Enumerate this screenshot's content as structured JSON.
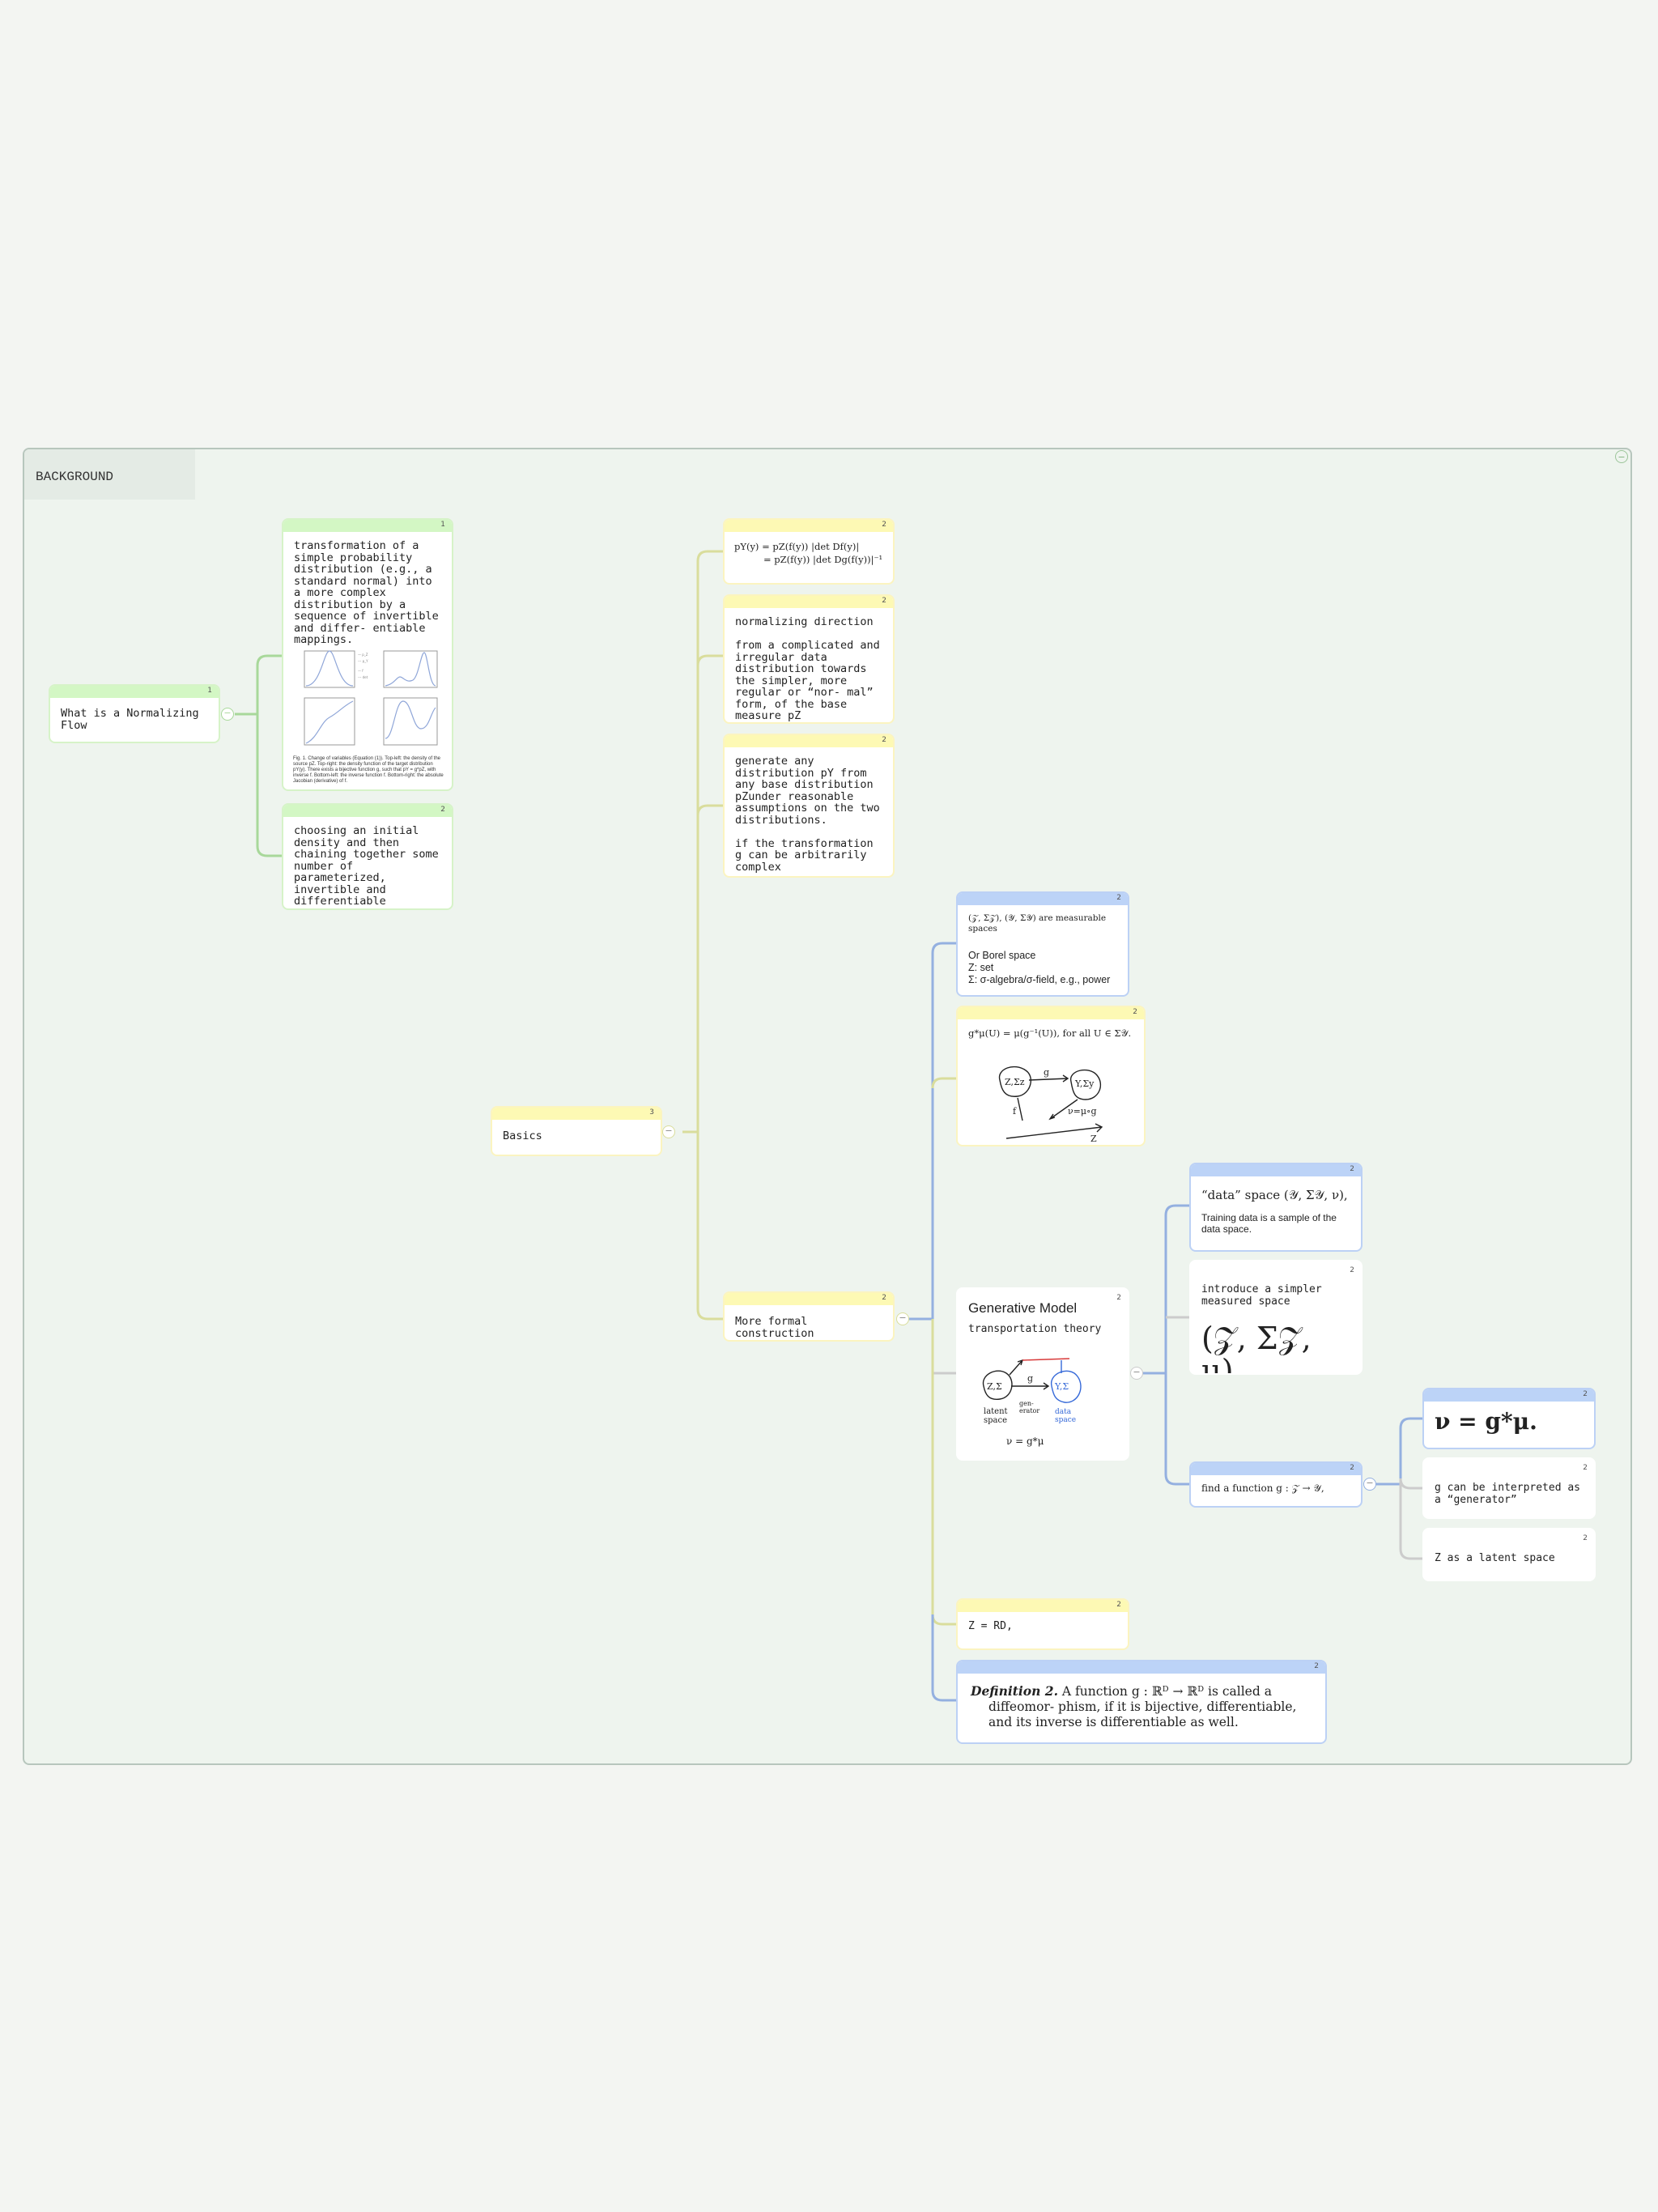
{
  "frame": {
    "label": "BACKGROUND"
  },
  "collapse_symbol": "−",
  "cards": {
    "root": {
      "count": "1",
      "text": "What is a Normalizing Flow"
    },
    "def": {
      "count": "1",
      "text": "transformation of a simple probability distribution (e.g., a standard normal) into a more complex distribution by a sequence of invertible and differ- entiable mappings.",
      "figure_caption": "Fig. 1. Change of variables (Equation (1)). Top-left: the density of the source pZ. Top-right: the density function of the target distribution pY(y). There exists a bijective function g, such that pY = g*pZ, with inverse f. Bottom-left: the inverse function f. Bottom-right: the absolute Jacobian (derivative) of f."
    },
    "choose": {
      "count": "2",
      "text": "choosing an initial density and then chaining together some number of parameterized, invertible and differentiable transformations"
    },
    "basics": {
      "count": "3",
      "text": "Basics"
    },
    "formula": {
      "count": "2",
      "line1": "pY(y) = pZ(f(y)) |det Df(y)|",
      "line2": "= pZ(f(y)) |det Dg(f(y))|⁻¹"
    },
    "normdir": {
      "count": "2",
      "text": "normalizing direction\n\nfrom a complicated and irregular data distribution towards the simpler, more regular or “nor- mal” form, of the base measure pZ"
    },
    "generate": {
      "count": "2",
      "text": "generate any distribution pY from any base distribution pZunder reasonable assumptions on the two distributions.\n\nif the transformation g can be arbitrarily complex"
    },
    "formal": {
      "count": "2",
      "text": "More formal construction"
    },
    "measurable": {
      "count": "2",
      "math": "(𝒵, Σ𝒵), (𝒴, Σ𝒴) are measurable spaces",
      "text": "Or Borel space\nZ: set\nΣ: σ-algebra/σ-field, e.g., power"
    },
    "pushforward": {
      "count": "2",
      "math": "g*μ(U) = μ(g⁻¹(U)),    for all U ∈ Σ𝒴."
    },
    "generative": {
      "count": "2",
      "title": "Generative Model",
      "subtitle": "transportation theory",
      "sketch": {
        "zs": "Z,Σ",
        "g": "g",
        "ys": "Y,Σ",
        "latent": "latent\nspace",
        "gen": "gen-\nerator",
        "data": "data\nspace",
        "nu": "ν = g*μ"
      }
    },
    "dataspace": {
      "count": "2",
      "math": "“data” space (𝒴, Σ𝒴, ν),",
      "text": "Training data is a sample of the data space."
    },
    "simpler": {
      "count": "2",
      "text": "introduce a simpler measured space",
      "math": "(𝒵, Σ𝒵, μ)"
    },
    "findfn": {
      "count": "2",
      "math": "find a function g : 𝒵 → 𝒴,"
    },
    "nu": {
      "count": "2",
      "math": "ν = g*μ."
    },
    "gen": {
      "count": "2",
      "text": "g can be interpreted as a “generator”"
    },
    "latent": {
      "count": "2",
      "text": "Z as a latent space"
    },
    "zrd": {
      "count": "2",
      "text": "Z = RD,"
    },
    "diffeo": {
      "count": "2",
      "lead": "Definition 2.",
      "text": " A function g : ℝᴰ → ℝᴰ is called a diffeomor- phism, if it is bijective, differentiable, and its inverse is differentiable as well."
    }
  },
  "sketch_pushforward": {
    "z": "Z,Σz",
    "y": "Y,Σy",
    "g": "g",
    "f": "f",
    "nu": "ν=μ∘g",
    "zlab": "Z"
  },
  "colors": {
    "green": "#a8d89a",
    "yellow": "#d9dd9c",
    "blue": "#94b0e0",
    "grey": "#cccccc"
  }
}
